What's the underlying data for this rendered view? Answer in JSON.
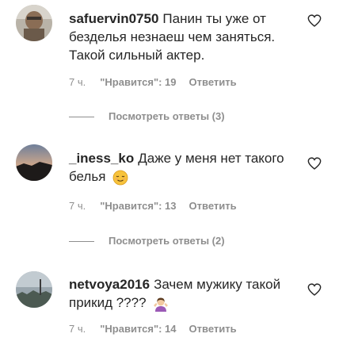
{
  "comments": [
    {
      "username": "safuervin0750",
      "text": "Панин ты уже от безделья незнаеш чем заняться. Такой сильный актер.",
      "time": "7 ч.",
      "likes": "\"Нравится\": 19",
      "reply": "Ответить",
      "view_replies": "Посмотреть ответы (3)"
    },
    {
      "username": "_iness_ko",
      "text": "Даже у меня нет такого белья",
      "emoji": "relieved-face-emoji",
      "time": "7 ч.",
      "likes": "\"Нравится\": 13",
      "reply": "Ответить",
      "view_replies": "Посмотреть ответы (2)"
    },
    {
      "username": "netvoya2016",
      "text": "Зачем мужику такой прикид ????",
      "emoji": "woman-shrugging-emoji",
      "time": "7 ч.",
      "likes": "\"Нравится\": 14",
      "reply": "Ответить"
    }
  ],
  "colors": {
    "text": "#262626",
    "secondary": "#8e8e8e",
    "background": "#ffffff"
  }
}
